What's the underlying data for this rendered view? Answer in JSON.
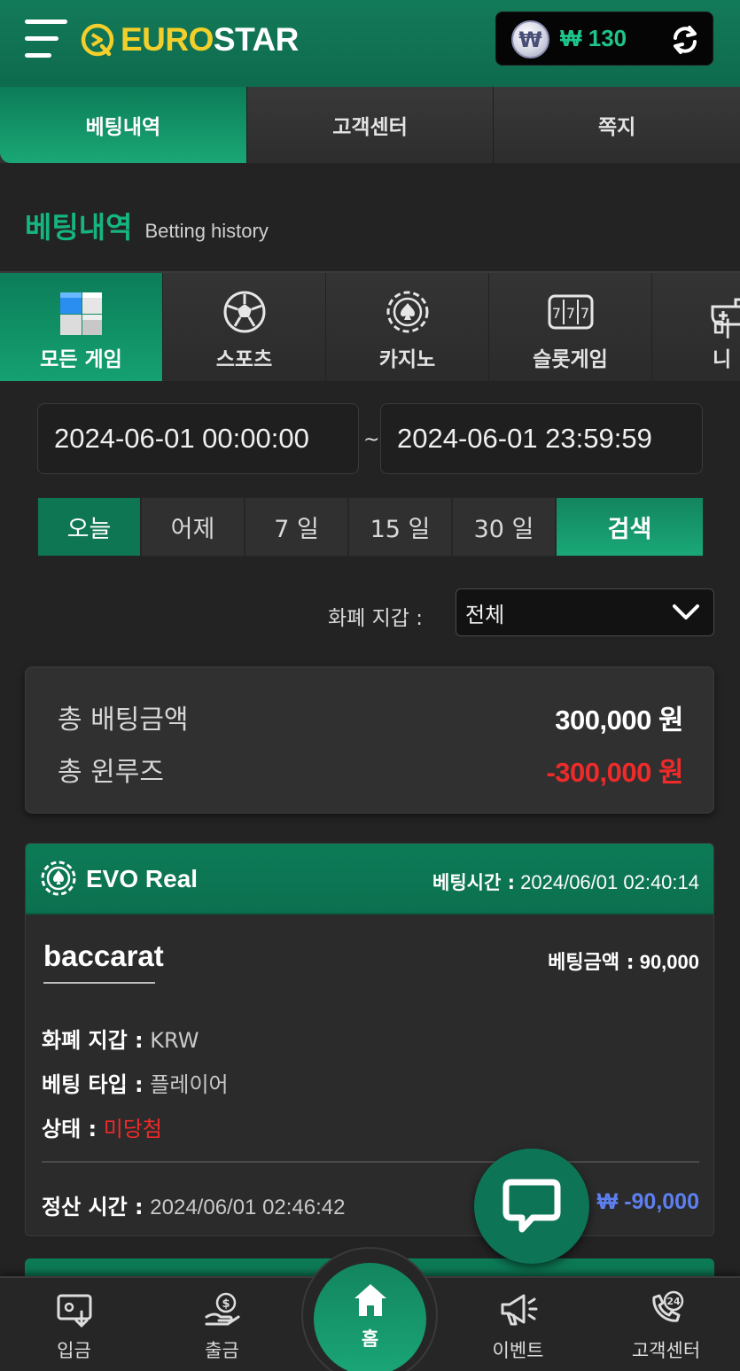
{
  "header": {
    "logo_yellow": "EURO",
    "logo_white": "STAR",
    "wallet_currency_symbol": "₩",
    "wallet_amount": "₩ 130"
  },
  "top_tabs": [
    "베팅내역",
    "고객센터",
    "쪽지"
  ],
  "section": {
    "title_ko": "베팅내역",
    "title_en": "Betting history"
  },
  "categories": [
    {
      "label": "모든 게임",
      "icon": "cubes-icon"
    },
    {
      "label": "스포츠",
      "icon": "soccer-ball-icon"
    },
    {
      "label": "카지노",
      "icon": "casino-chip-icon"
    },
    {
      "label": "슬롯게임",
      "icon": "slot-machine-icon"
    },
    {
      "label": "미니",
      "icon": "gamepad-icon"
    }
  ],
  "date_range": {
    "from": "2024-06-01 00:00:00",
    "separator": "~",
    "to": "2024-06-01 23:59:59"
  },
  "quick_ranges": [
    "오늘",
    "어제",
    "7 일",
    "15 일",
    "30 일"
  ],
  "search_label": "검색",
  "currency_filter": {
    "label": "화폐 지갑 :",
    "value": "전체"
  },
  "summary": {
    "total_bet_label": "총 배팅금액",
    "total_bet_value": "300,000 원",
    "win_loss_label": "총 윈루즈",
    "win_loss_value": "-300,000 원"
  },
  "bet": {
    "provider": "EVO Real",
    "time_label": "베팅시간 :",
    "time_value": "2024/06/01 02:40:14",
    "game": "baccarat",
    "amount_label": "베팅금액 :",
    "amount_value": "90,000",
    "currency_label": "화폐 지갑 :",
    "currency_value": "KRW",
    "type_label": "베팅 타입 :",
    "type_value": "플레이어",
    "status_label": "상태 :",
    "status_value": "미당첨",
    "settle_label": "정산 시간 :",
    "settle_value": "2024/06/01 02:46:42",
    "payout": "₩ -90,000"
  },
  "bottom_nav": {
    "deposit": "입금",
    "withdraw": "출금",
    "home": "홈",
    "event": "이벤트",
    "support": "고객센터",
    "support_badge": "24"
  },
  "colors": {
    "brand_green": "#0f7654",
    "accent_green": "#1aa877",
    "logo_yellow": "#f2cf2b",
    "loss_red": "#ef2a2a",
    "payout_blue": "#5d7ff0"
  }
}
